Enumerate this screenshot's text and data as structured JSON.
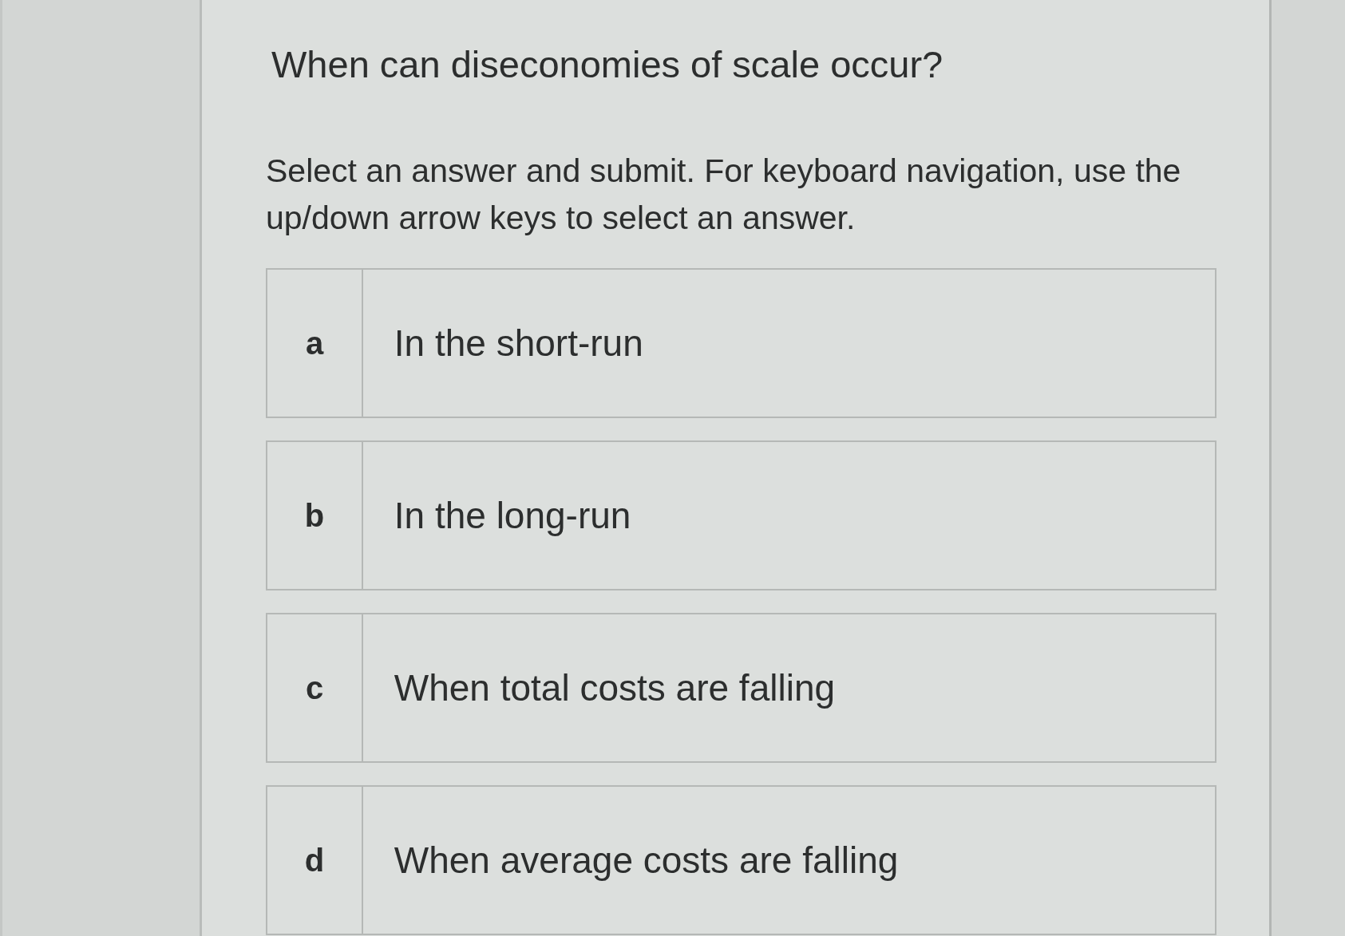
{
  "question": {
    "title": "When can diseconomies of scale occur?",
    "instructions": "Select an answer and submit. For keyboard navigation, use the up/down arrow keys to select an answer."
  },
  "options": [
    {
      "letter": "a",
      "text": "In the short-run",
      "selected": false
    },
    {
      "letter": "b",
      "text": "In the long-run",
      "selected": false
    },
    {
      "letter": "c",
      "text": "When total costs are falling",
      "selected": false
    },
    {
      "letter": "d",
      "text": "When average costs are falling",
      "selected": false
    }
  ]
}
